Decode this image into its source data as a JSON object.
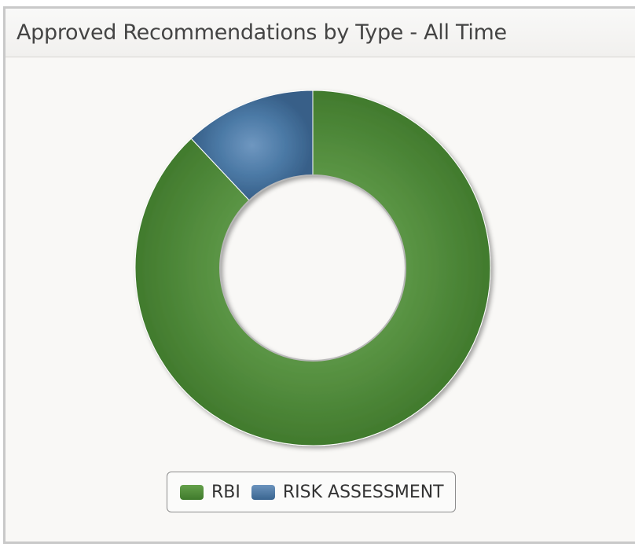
{
  "panel": {
    "title": "Approved Recommendations by Type - All Time"
  },
  "chart_data": {
    "type": "pie",
    "style": "donut",
    "title": "Approved Recommendations by Type - All Time",
    "categories": [
      "RBI",
      "RISK ASSESSMENT"
    ],
    "values": [
      88,
      12
    ],
    "colors": [
      "#4e8838",
      "#45709a"
    ],
    "legend_position": "bottom"
  }
}
